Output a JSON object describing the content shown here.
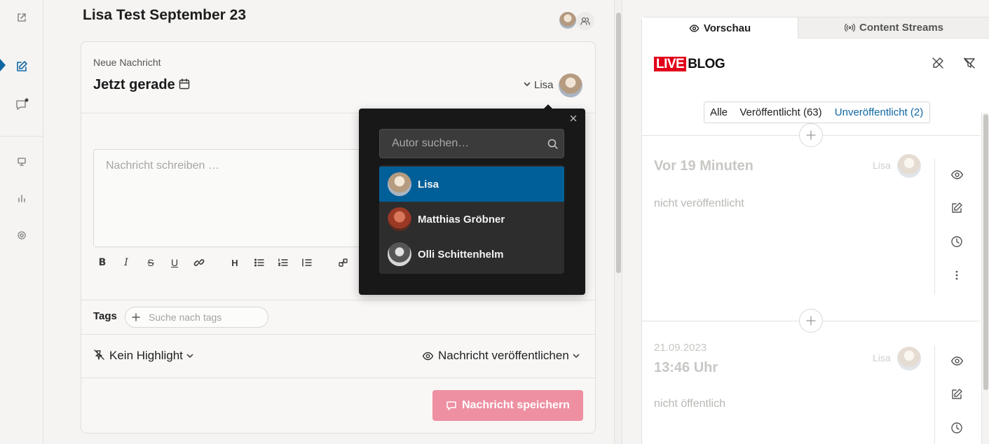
{
  "blog_title": "Lisa Test September 23",
  "editor": {
    "label": "Neue Nachricht",
    "time": "Jetzt gerade",
    "author": "Lisa",
    "textarea_placeholder": "Nachricht schreiben …",
    "tags_label": "Tags",
    "tags_placeholder": "Suche nach tags",
    "highlight_label": "Kein Highlight",
    "publish_label": "Nachricht veröffentlichen",
    "save_button": "Nachricht speichern"
  },
  "author_popup": {
    "search_placeholder": "Autor suchen…",
    "authors": [
      {
        "name": "Lisa",
        "selected": true
      },
      {
        "name": "Matthias Gröbner",
        "selected": false
      },
      {
        "name": "Olli Schittenhelm",
        "selected": false
      }
    ]
  },
  "preview": {
    "tabs": [
      "Vorschau",
      "Content Streams"
    ],
    "logo": {
      "live": "LIVE",
      "blog": "BLOG"
    },
    "filters": [
      "Alle",
      "Veröffentlicht (63)",
      "Unveröffentlicht (2)"
    ],
    "posts": [
      {
        "date": "",
        "time": "Vor 19 Minuten",
        "author": "Lisa",
        "status": "nicht veröffentlicht"
      },
      {
        "date": "21.09.2023",
        "time": "13:46 Uhr",
        "author": "Lisa",
        "status": "nicht öffentlich"
      }
    ]
  },
  "colors": {
    "accent": "#0f67a3",
    "selected_row": "#005f99",
    "save_button": "#ee8fa2",
    "logo_red": "#e2001a"
  }
}
